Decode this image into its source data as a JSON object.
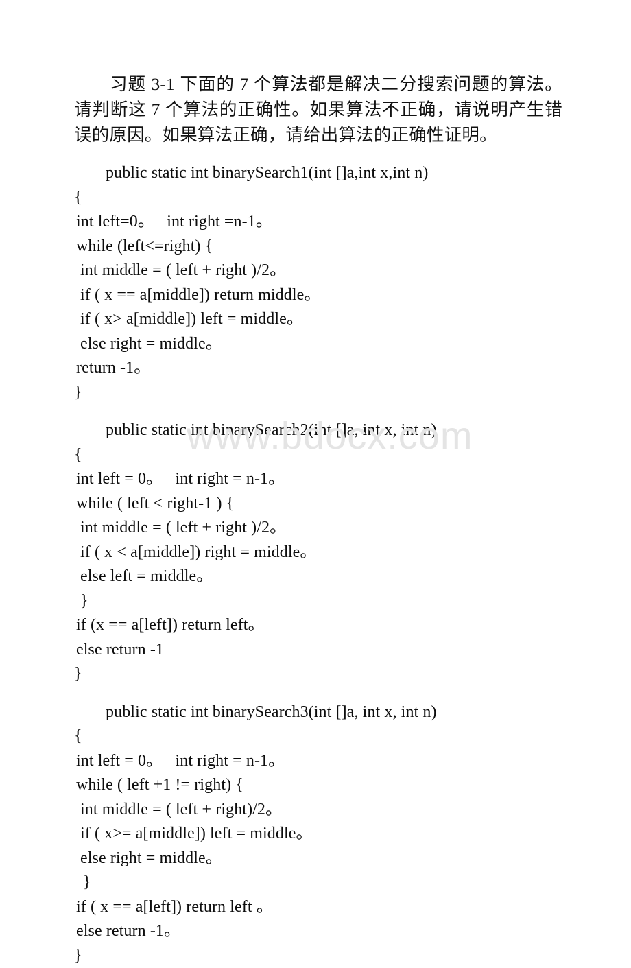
{
  "document": {
    "intro_paragraph": "习题 3-1  下面的 7 个算法都是解决二分搜索问题的算法。请判断这 7 个算法的正确性。如果算法不正确，请说明产生错误的原因。如果算法正确，请给出算法的正确性证明。",
    "watermark": "www.bdocx.com"
  },
  "listings": [
    {
      "id": "binarySearch1",
      "signature": "public static int binarySearch1(int []a,int x,int n)",
      "lines": [
        {
          "text": "{",
          "indent": 0
        },
        {
          "text": "int left=0。   int right =n-1。",
          "indent": 1
        },
        {
          "text": "while (left<=right) {",
          "indent": 1
        },
        {
          "text": "int middle = ( left + right )/2。",
          "indent": 2
        },
        {
          "text": "if ( x == a[middle]) return middle。",
          "indent": 2
        },
        {
          "text": "if ( x> a[middle]) left = middle。",
          "indent": 2
        },
        {
          "text": "else right = middle。",
          "indent": 2
        },
        {
          "text": "return -1。",
          "indent": 1
        },
        {
          "text": "}",
          "indent": 0
        }
      ]
    },
    {
      "id": "binarySearch2",
      "signature": "public static int binarySearch2(int []a, int x, int n)",
      "lines": [
        {
          "text": "{",
          "indent": 0
        },
        {
          "text": "int left = 0。   int right = n-1。",
          "indent": 1
        },
        {
          "text": "while ( left < right-1 ) {",
          "indent": 1
        },
        {
          "text": "int middle = ( left + right )/2。",
          "indent": 2
        },
        {
          "text": "if ( x < a[middle]) right = middle。",
          "indent": 2
        },
        {
          "text": "else left = middle。",
          "indent": 2
        },
        {
          "text": "}",
          "indent": 2
        },
        {
          "text": "if (x == a[left]) return left。",
          "indent": 1
        },
        {
          "text": "else return -1",
          "indent": 1
        },
        {
          "text": "}",
          "indent": 0
        }
      ]
    },
    {
      "id": "binarySearch3",
      "signature": "public static int binarySearch3(int []a, int x, int n)",
      "lines": [
        {
          "text": "{",
          "indent": 0
        },
        {
          "text": "int left = 0。   int right = n-1。",
          "indent": 1
        },
        {
          "text": "while ( left +1 != right) {",
          "indent": 1
        },
        {
          "text": "int middle = ( left + right)/2。",
          "indent": 2
        },
        {
          "text": "if ( x>= a[middle]) left = middle。",
          "indent": 2
        },
        {
          "text": "else right = middle。",
          "indent": 2
        },
        {
          "text": "}",
          "indent": 3
        },
        {
          "text": "if ( x == a[left]) return left 。",
          "indent": 1
        },
        {
          "text": "else return -1。",
          "indent": 1
        },
        {
          "text": "}",
          "indent": 0
        }
      ]
    }
  ]
}
